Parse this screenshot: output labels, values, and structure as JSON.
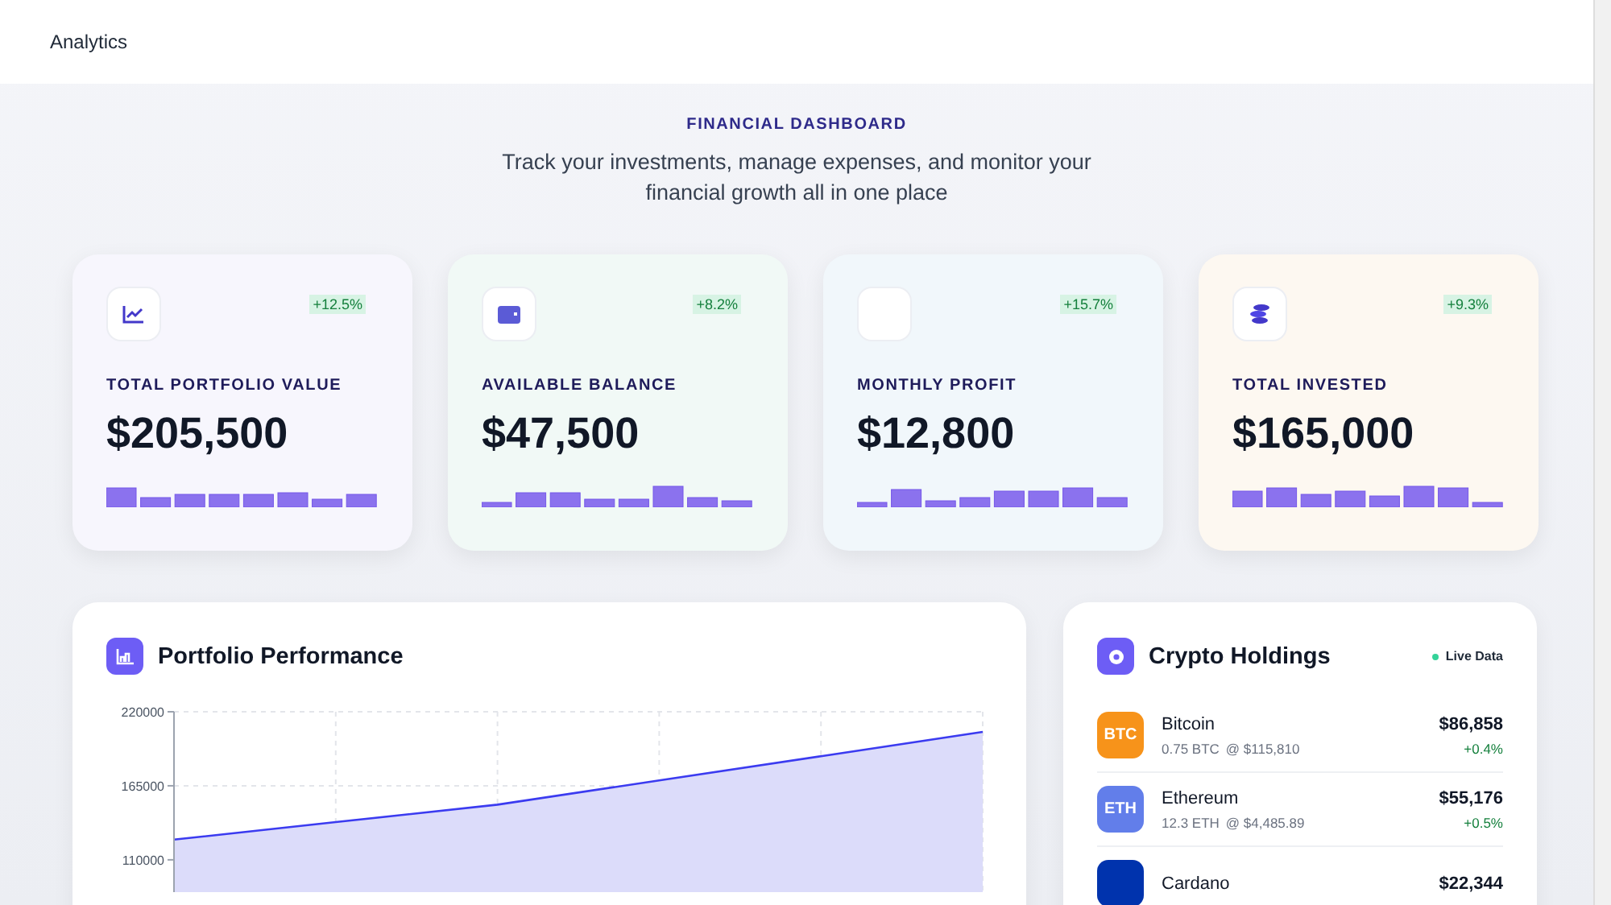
{
  "header": {
    "title": "Analytics"
  },
  "hero": {
    "eyebrow": "FINANCIAL DASHBOARD",
    "subtitle": "Track your investments, manage expenses, and monitor your financial growth all in one place"
  },
  "stats": [
    {
      "kind": "chart",
      "label": "TOTAL PORTFOLIO VALUE",
      "value": "$205,500",
      "change": "+12.5%",
      "color": "#f7f6fd"
    },
    {
      "kind": "wallet",
      "label": "AVAILABLE BALANCE",
      "value": "$47,500",
      "change": "+8.2%",
      "color": "#f1f9f6"
    },
    {
      "kind": "blank",
      "label": "MONTHLY PROFIT",
      "value": "$12,800",
      "change": "+15.7%",
      "color": "#f1f7fb"
    },
    {
      "kind": "coins",
      "label": "TOTAL INVESTED",
      "value": "$165,000",
      "change": "+9.3%",
      "color": "#fdf8f1"
    }
  ],
  "performance": {
    "title": "Portfolio Performance",
    "chart_data": {
      "type": "area",
      "series": [
        {
          "color": "#3b3bf0",
          "values": [
            125000,
            138000,
            151000,
            169000,
            187000,
            205000
          ]
        }
      ],
      "ylim": [
        86000,
        220000
      ],
      "grid": true,
      "yticks": [
        110000,
        165000,
        220000
      ]
    }
  },
  "crypto": {
    "title": "Crypto Holdings",
    "live_label": "Live Data",
    "holdings": [
      {
        "symbol": "BTC",
        "name": "Bitcoin",
        "amount": "0.75 BTC",
        "price": "@ $115,810",
        "value": "$86,858",
        "change": "+0.4%",
        "color": "#f7931a"
      },
      {
        "symbol": "ETH",
        "name": "Ethereum",
        "amount": "12.3 ETH",
        "price": "@ $4,485.89",
        "value": "$55,176",
        "change": "+0.5%",
        "color": "#627eea"
      },
      {
        "name": "Cardano",
        "value": "$22,344",
        "color": "#0033ad"
      }
    ]
  }
}
